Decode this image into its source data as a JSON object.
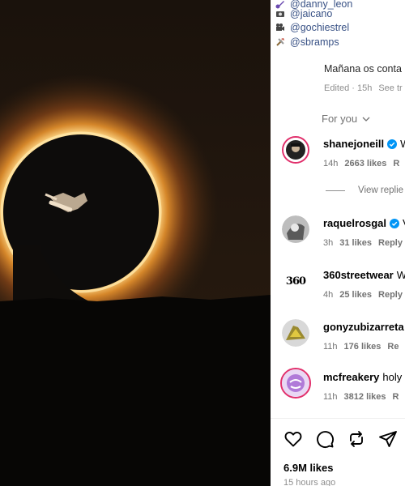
{
  "post": {
    "credits": [
      {
        "icon": "guitar-icon",
        "handle": "@danny_leon"
      },
      {
        "icon": "camera-icon",
        "handle": "@jaicano"
      },
      {
        "icon": "video-camera-icon",
        "handle": "@gochiestrel"
      },
      {
        "icon": "tools-icon",
        "handle": "@sbramps"
      }
    ],
    "caption": "Mañana os conta",
    "edited": "Edited · 15h",
    "see_translation": "See tr",
    "sort_label": "For you"
  },
  "comments": [
    {
      "username": "shanejoneill",
      "verified": true,
      "text": "W",
      "time": "14h",
      "likes": "2663 likes",
      "reply": "R"
    },
    {
      "username": "raquelrosgal",
      "verified": true,
      "text": "V",
      "time": "3h",
      "likes": "31 likes",
      "reply": "Reply"
    },
    {
      "username": "360streetwear",
      "verified": false,
      "text": "W",
      "time": "4h",
      "likes": "25 likes",
      "reply": "Reply"
    },
    {
      "username": "gonyzubizarreta",
      "verified": false,
      "text": "",
      "time": "11h",
      "likes": "176 likes",
      "reply": "Re"
    },
    {
      "username": "mcfreakery",
      "verified": false,
      "text": "holy",
      "time": "11h",
      "likes": "3812 likes",
      "reply": "R"
    }
  ],
  "view_replies": "View replie",
  "actions": {
    "like_icon": "heart-icon",
    "comment_icon": "comment-icon",
    "share_icon": "repost-icon",
    "send_icon": "send-icon"
  },
  "likes_count": "6.9M likes",
  "time_ago": "15 hours ago",
  "avatar_360_text": "360",
  "colors": {
    "link": "#385185",
    "verified": "#0095f6",
    "meta": "#737373"
  }
}
